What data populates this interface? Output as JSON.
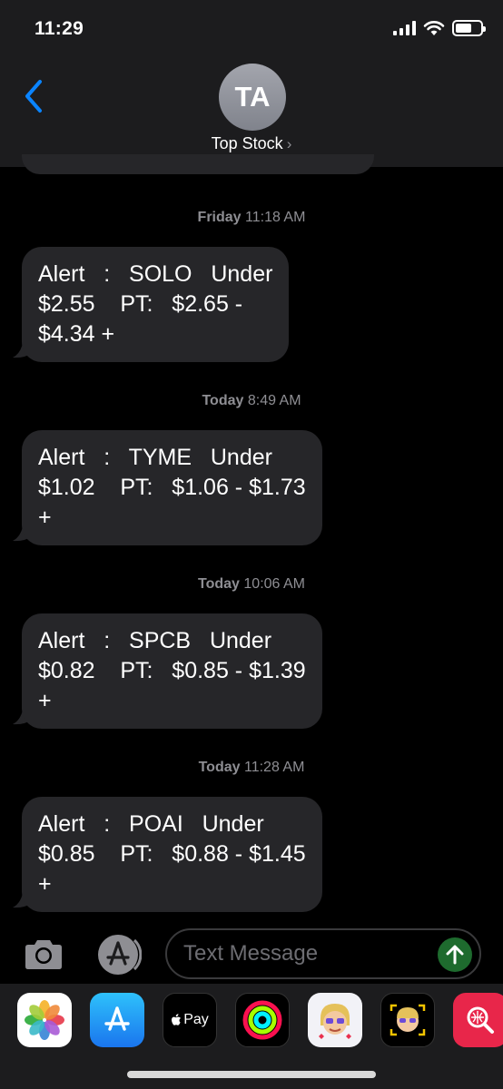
{
  "status_bar": {
    "time": "11:29"
  },
  "header": {
    "avatar_initials": "TA",
    "contact_name": "Top Stock",
    "chevron": "›"
  },
  "messages": [
    {
      "timestamp_day": "Friday",
      "timestamp_time": "11:18 AM",
      "text": "Alert   :   SOLO   Under\n$2.55    PT:   $2.65 -\n$4.34 +"
    },
    {
      "timestamp_day": "Today",
      "timestamp_time": "8:49 AM",
      "text": "Alert   :   TYME   Under\n$1.02    PT:   $1.06 - $1.73\n+"
    },
    {
      "timestamp_day": "Today",
      "timestamp_time": "10:06 AM",
      "text": "Alert   :   SPCB   Under\n$0.82    PT:   $0.85 - $1.39\n+"
    },
    {
      "timestamp_day": "Today",
      "timestamp_time": "11:28 AM",
      "text": "Alert   :   POAI   Under\n$0.85    PT:   $0.88 - $1.45\n+"
    }
  ],
  "composer": {
    "placeholder": "Text Message"
  },
  "app_drawer": {
    "apple_pay_label": "Pay",
    "apps": [
      "photos-icon",
      "app-store-icon",
      "apple-pay-icon",
      "activity-icon",
      "memoji-icon",
      "animoji-icon",
      "web-search-icon"
    ]
  },
  "colors": {
    "background": "#000000",
    "header": "#1c1c1e",
    "bubble": "#262629",
    "timestamp": "#8e8e93",
    "back_accent": "#0a84ff",
    "send_button": "#1e6b2e"
  }
}
